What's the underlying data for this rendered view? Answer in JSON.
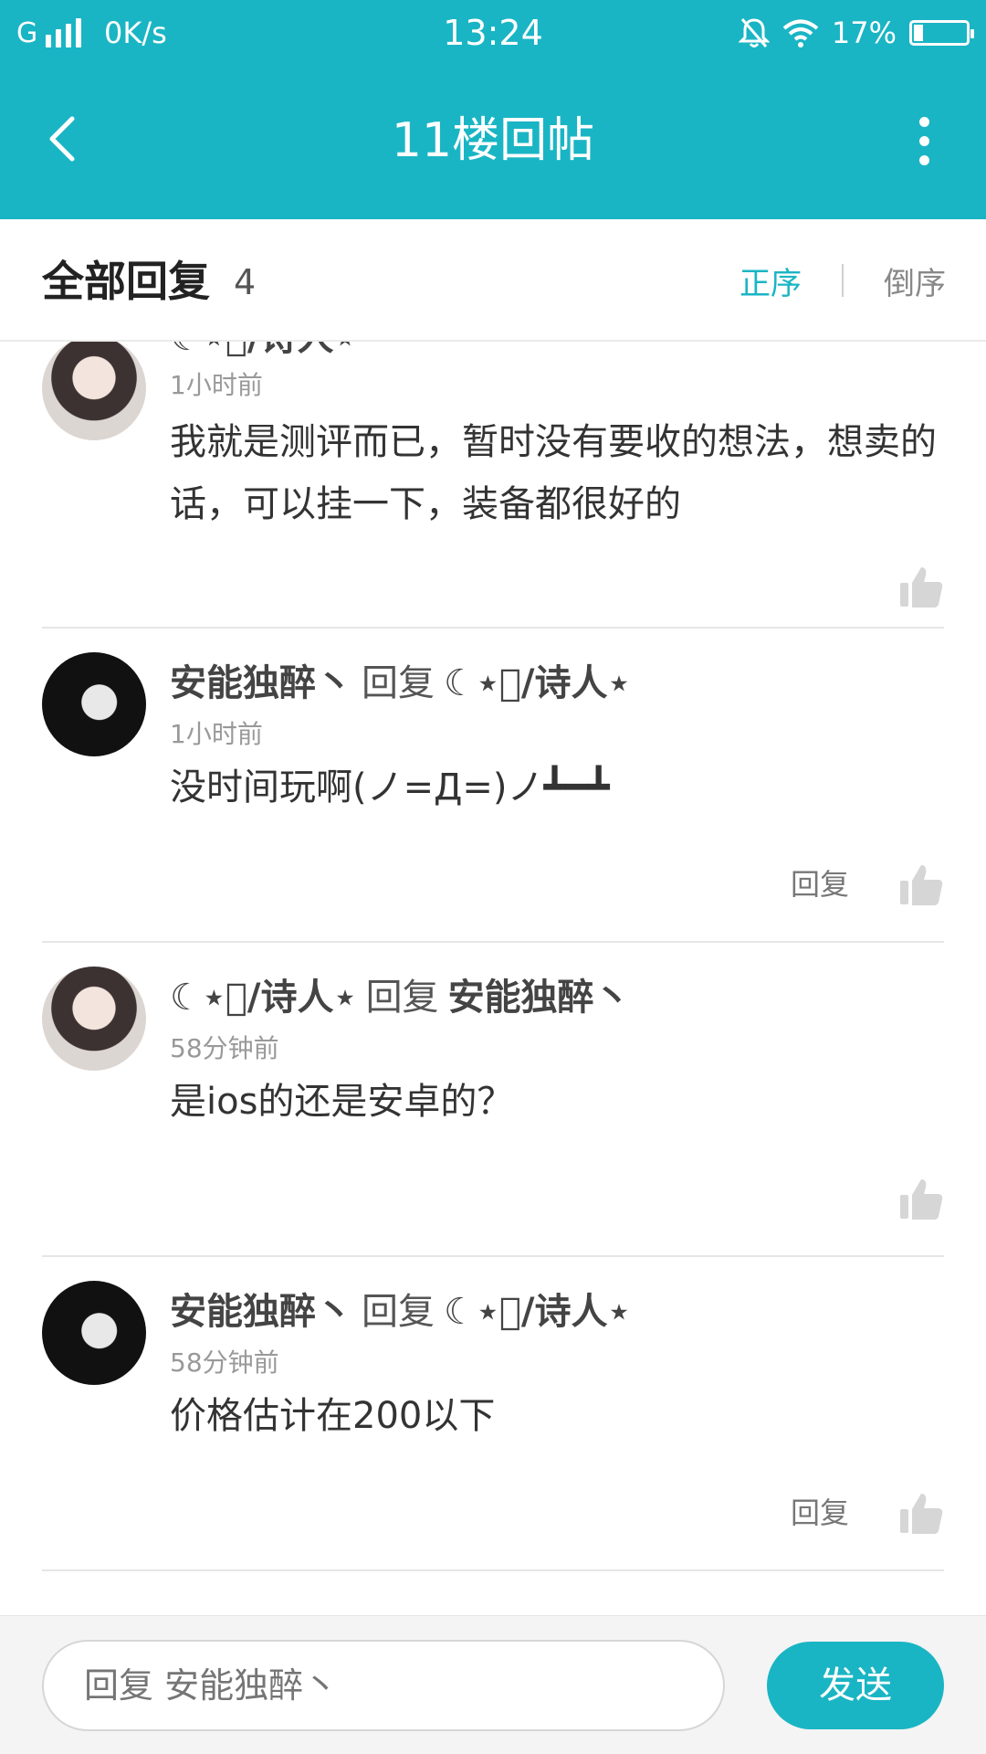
{
  "status_bar": {
    "network": "G",
    "speed": "0K/s",
    "time": "13:24",
    "battery": "17%",
    "battery_level": 0.17,
    "icons": [
      "signal-icon",
      "mute-icon",
      "wifi-icon",
      "battery-icon"
    ]
  },
  "app_bar": {
    "title": "11楼回帖",
    "icons": [
      "back-arrow-icon",
      "more-vert-icon"
    ]
  },
  "section": {
    "label": "全部回复",
    "count": "4",
    "sort_asc": "正序",
    "sort_desc": "倒序",
    "accent_color": "#1ab5c4"
  },
  "replies": [
    {
      "author": "☾⋆ᷤ/诗人⋆",
      "reply_word": "",
      "reply_to": "",
      "time": "1小时前",
      "content": "我就是测评而已，暂时没有要收的想法，想卖的话，可以挂一下，装备都很好的",
      "reply_label": "",
      "avatar": "girl"
    },
    {
      "author": "安能独醉丶",
      "reply_word": "回复",
      "reply_to": "☾⋆ᷤ/诗人⋆",
      "time": "1小时前",
      "content": "没时间玩啊(ノ=Д=)ノ┻━┻",
      "reply_label": "回复",
      "avatar": "boy"
    },
    {
      "author": "☾⋆ᷤ/诗人⋆",
      "reply_word": "回复",
      "reply_to": "安能独醉丶",
      "time": "58分钟前",
      "content": "是ios的还是安卓的？",
      "reply_label": "",
      "avatar": "girl"
    },
    {
      "author": "安能独醉丶",
      "reply_word": "回复",
      "reply_to": "☾⋆ᷤ/诗人⋆",
      "time": "58分钟前",
      "content": "价格估计在200以下",
      "reply_label": "回复",
      "avatar": "boy"
    }
  ],
  "bottom_bar": {
    "placeholder": "回复 安能独醉丶",
    "send_label": "发送"
  }
}
